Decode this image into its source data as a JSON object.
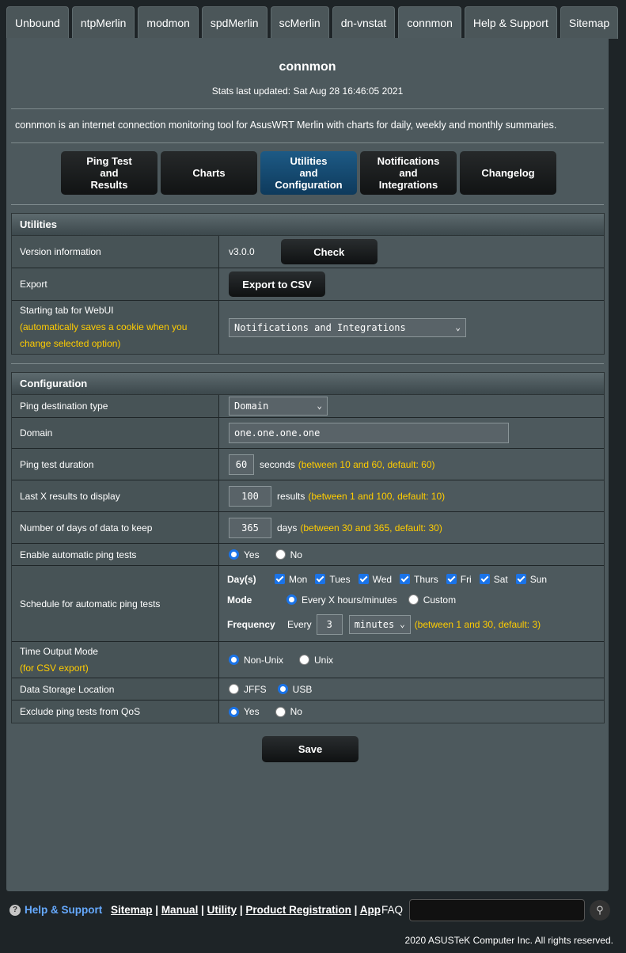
{
  "top_tabs": [
    "Unbound",
    "ntpMerlin",
    "modmon",
    "spdMerlin",
    "scMerlin",
    "dn-vnstat",
    "connmon",
    "Help & Support",
    "Sitemap"
  ],
  "header": {
    "title": "connmon",
    "updated": "Stats last updated: Sat Aug 28 16:46:05 2021",
    "description": "connmon is an internet connection monitoring tool for AsusWRT Merlin with charts for daily, weekly and monthly summaries."
  },
  "subtabs": [
    "Ping Test\nand\nResults",
    "Charts",
    "Utilities\nand\nConfiguration",
    "Notifications\nand\nIntegrations",
    "Changelog"
  ],
  "utilities": {
    "heading": "Utilities",
    "version_label": "Version information",
    "version_value": "v3.0.0",
    "check_button": "Check",
    "export_label": "Export",
    "export_button": "Export to CSV",
    "start_tab_label": "Starting tab for WebUI",
    "start_tab_hint": "(automatically saves a cookie when you change selected option)",
    "start_tab_value": "Notifications and Integrations"
  },
  "config": {
    "heading": "Configuration",
    "dest_type_label": "Ping destination type",
    "dest_type_value": "Domain",
    "domain_label": "Domain",
    "domain_value": "one.one.one.one",
    "duration_label": "Ping test duration",
    "duration_value": "60",
    "duration_unit": "seconds",
    "duration_hint": "(between 10 and 60, default: 60)",
    "lastx_label": "Last X results to display",
    "lastx_value": "100",
    "lastx_unit": "results",
    "lastx_hint": "(between 1 and 100, default: 10)",
    "days_label": "Number of days of data to keep",
    "days_value": "365",
    "days_unit": "days",
    "days_hint": "(between 30 and 365, default: 30)",
    "auto_label": "Enable automatic ping tests",
    "yes": "Yes",
    "no": "No",
    "schedule_label": "Schedule for automatic ping tests",
    "days_heading": "Day(s)",
    "weekdays": [
      "Mon",
      "Tues",
      "Wed",
      "Thurs",
      "Fri",
      "Sat",
      "Sun"
    ],
    "mode_heading": "Mode",
    "mode_opt1": "Every X hours/minutes",
    "mode_opt2": "Custom",
    "freq_heading": "Frequency",
    "freq_every": "Every",
    "freq_value": "3",
    "freq_unit": "minutes",
    "freq_hint": "(between 1 and 30, default: 3)",
    "time_label": "Time Output Mode",
    "time_hint": "(for CSV export)",
    "time_opt1": "Non-Unix",
    "time_opt2": "Unix",
    "storage_label": "Data Storage Location",
    "storage_opt1": "JFFS",
    "storage_opt2": "USB",
    "qos_label": "Exclude ping tests from QoS"
  },
  "save_button": "Save",
  "footer": {
    "help": "Help & Support",
    "links": [
      "Sitemap",
      "Manual",
      "Utility",
      "Product Registration",
      "App"
    ],
    "faq": "FAQ",
    "copyright": "2020 ASUSTeK Computer Inc. All rights reserved."
  }
}
